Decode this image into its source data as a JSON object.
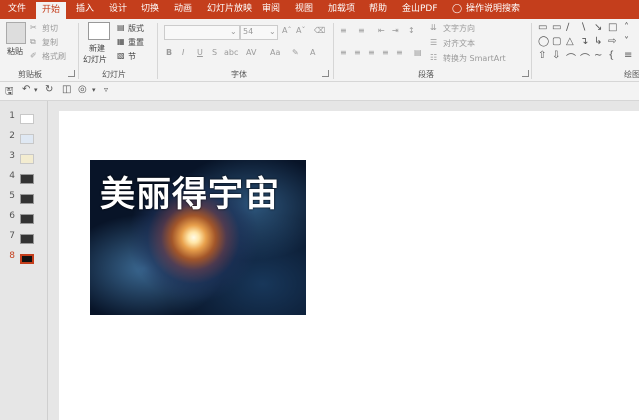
{
  "menubar": {
    "items": [
      "文件",
      "开始",
      "插入",
      "设计",
      "切换",
      "动画",
      "幻灯片放映",
      "审阅",
      "视图",
      "加载项",
      "帮助",
      "金山PDF",
      "操作说明搜索"
    ],
    "active": "开始"
  },
  "ribbon": {
    "clipboard": {
      "paste": "粘贴",
      "cut": "剪切",
      "copy": "复制",
      "format_painter": "格式刷",
      "label": "剪贴板"
    },
    "slides": {
      "new_slide": "新建",
      "new_slide2": "幻灯片",
      "layout": "版式",
      "reset": "重置",
      "section": "节",
      "label": "幻灯片"
    },
    "font": {
      "size": "54",
      "label": "字体",
      "bold": "B",
      "italic": "I",
      "underline": "U",
      "strike": "S",
      "shadow": "abc",
      "spacing": "AV",
      "case": "Aa"
    },
    "paragraph": {
      "text_direction": "文字方向",
      "align_text": "对齐文本",
      "smartart": "转换为 SmartArt",
      "label": "段落"
    },
    "drawing": {
      "label": "绘图"
    }
  },
  "slides_pane": {
    "numbers": [
      "1",
      "2",
      "3",
      "4",
      "5",
      "6",
      "7",
      "8"
    ],
    "active_index": 8
  },
  "slide": {
    "title": "美丽得宇宙"
  },
  "colors": {
    "accent": "#c43e1c"
  }
}
